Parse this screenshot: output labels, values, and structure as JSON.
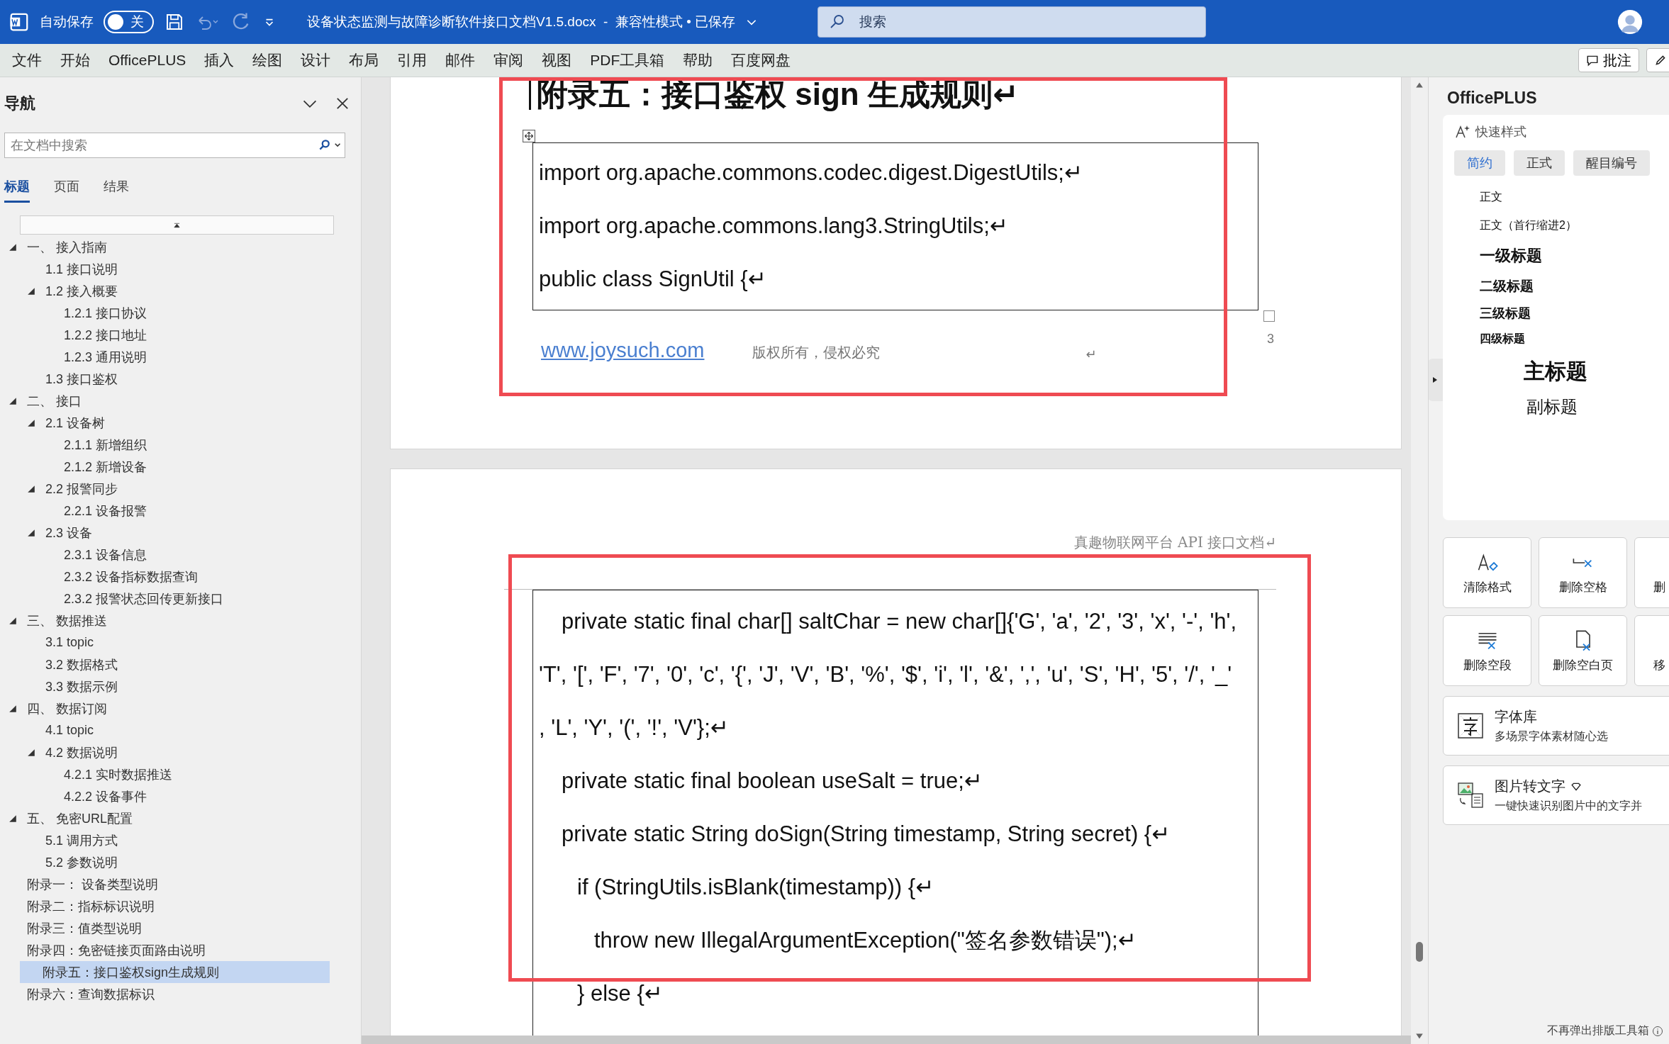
{
  "title_bar": {
    "autosave_label": "自动保存",
    "autosave_toggle": {
      "on": false,
      "label": "关"
    },
    "document_title": "设备状态监测与故障诊断软件接口文档V1.5.docx  -  兼容性模式 • 已保存",
    "search_placeholder": "搜索"
  },
  "ribbon_tabs": [
    "文件",
    "开始",
    "OfficePLUS",
    "插入",
    "绘图",
    "设计",
    "布局",
    "引用",
    "邮件",
    "审阅",
    "视图",
    "PDF工具箱",
    "帮助",
    "百度网盘"
  ],
  "ribbon_buttons": {
    "comment": "批注"
  },
  "navigation": {
    "title": "导航",
    "search_placeholder": "在文档中搜索",
    "tabs": [
      {
        "label": "标题",
        "selected": true
      },
      {
        "label": "页面",
        "selected": false
      },
      {
        "label": "结果",
        "selected": false
      }
    ],
    "outline": [
      {
        "label": "一、 接入指南",
        "expanded": true,
        "selected": false,
        "children": [
          {
            "label": "1.1 接口说明",
            "selected": false
          },
          {
            "label": "1.2 接入概要",
            "expanded": true,
            "selected": false,
            "children": [
              {
                "label": "1.2.1 接口协议",
                "selected": false
              },
              {
                "label": "1.2.2 接口地址",
                "selected": false
              },
              {
                "label": "1.2.3 通用说明",
                "selected": false
              }
            ]
          },
          {
            "label": "1.3 接口鉴权",
            "selected": false
          }
        ]
      },
      {
        "label": "二、 接口",
        "expanded": true,
        "selected": false,
        "children": [
          {
            "label": "2.1 设备树",
            "expanded": true,
            "selected": false,
            "children": [
              {
                "label": "2.1.1 新增组织",
                "selected": false
              },
              {
                "label": "2.1.2 新增设备",
                "selected": false
              }
            ]
          },
          {
            "label": "2.2 报警同步",
            "expanded": true,
            "selected": false,
            "children": [
              {
                "label": "2.2.1 设备报警",
                "selected": false
              }
            ]
          },
          {
            "label": "2.3 设备",
            "expanded": true,
            "selected": false,
            "children": [
              {
                "label": "2.3.1 设备信息",
                "selected": false
              },
              {
                "label": "2.3.2 设备指标数据查询",
                "selected": false
              },
              {
                "label": "2.3.2 报警状态回传更新接口",
                "selected": false
              }
            ]
          }
        ]
      },
      {
        "label": "三、 数据推送",
        "expanded": true,
        "selected": false,
        "children": [
          {
            "label": "3.1 topic",
            "selected": false
          },
          {
            "label": "3.2 数据格式",
            "selected": false
          },
          {
            "label": "3.3 数据示例",
            "selected": false
          }
        ]
      },
      {
        "label": "四、 数据订阅",
        "expanded": true,
        "selected": false,
        "children": [
          {
            "label": "4.1 topic",
            "selected": false
          },
          {
            "label": "4.2 数据说明",
            "expanded": true,
            "selected": false,
            "children": [
              {
                "label": "4.2.1 实时数据推送",
                "selected": false
              },
              {
                "label": "4.2.2 设备事件",
                "selected": false
              }
            ]
          }
        ]
      },
      {
        "label": "五、 免密URL配置",
        "expanded": true,
        "selected": false,
        "children": [
          {
            "label": "5.1 调用方式",
            "selected": false
          },
          {
            "label": "5.2 参数说明",
            "selected": false
          }
        ]
      },
      {
        "label": "附录一： 设备类型说明",
        "selected": false
      },
      {
        "label": "附录二：指标标识说明",
        "selected": false
      },
      {
        "label": "附录三：值类型说明",
        "selected": false
      },
      {
        "label": "附录四：免密链接页面路由说明",
        "selected": false
      },
      {
        "label": "附录五：接口鉴权sign生成规则",
        "selected": true
      },
      {
        "label": "附录六：查询数据标识",
        "selected": false
      }
    ]
  },
  "document": {
    "page_1": {
      "highlighted": true,
      "heading": "附录五：接口鉴权 sign 生成规则↵",
      "code_lines": [
        {
          "text": "import org.apache.commons.codec.digest.DigestUtils;↵",
          "kind": "plain"
        },
        {
          "text": "import org.apache.commons.lang3.StringUtils;↵",
          "kind": "plain"
        },
        {
          "text": "public class SignUtil {↵",
          "kind": "plain"
        }
      ],
      "footer_link": "www.joysuch.com",
      "footer_text": "版权所有，侵权必究",
      "footer_mark": "↵",
      "page_number": "3"
    },
    "page_2": {
      "highlighted": true,
      "header": "真趣物联网平台 API 接口文档↵",
      "code_lines": [
        {
          "text": "private static final char[] saltChar = new char[]{'G', 'a', '2', '3', 'x', '-', 'h',",
          "kind": "member"
        },
        {
          "text": "'T', '[', 'F', '7', '0', 'c', '{', 'J', 'V', 'B', '%', '$', 'i', 'l', '&', ',', 'u', 'S', 'H', '5', '/', '_'",
          "kind": "continuation"
        },
        {
          "text": ", 'L', 'Y', '(', '!', 'V'};↵",
          "kind": "continuation"
        },
        {
          "text": "private static final boolean useSalt = true;↵",
          "kind": "member"
        },
        {
          "text": "private static String doSign(String timestamp, String secret) {↵",
          "kind": "member"
        },
        {
          "text": "if (StringUtils.isBlank(timestamp)) {↵",
          "kind": "block"
        },
        {
          "text": "throw new IllegalArgumentException(\"签名参数错误\");↵",
          "kind": "nested"
        },
        {
          "text": "} else {↵",
          "kind": "block"
        }
      ]
    }
  },
  "office_plus": {
    "title": "OfficePLUS",
    "quick_styles_label": "快速样式",
    "style_tabs": [
      {
        "label": "简约",
        "selected": true
      },
      {
        "label": "正式",
        "selected": false
      },
      {
        "label": "醒目编号",
        "selected": false
      }
    ],
    "styles": [
      {
        "label": "正文",
        "kind": "body"
      },
      {
        "label": "正文（首行缩进2）",
        "kind": "body"
      },
      {
        "label": "一级标题",
        "kind": "h1"
      },
      {
        "label": "二级标题",
        "kind": "h2"
      },
      {
        "label": "三级标题",
        "kind": "h3"
      },
      {
        "label": "四级标题",
        "kind": "h4"
      },
      {
        "label": "主标题",
        "kind": "title"
      },
      {
        "label": "副标题",
        "kind": "subtitle"
      }
    ],
    "tools": [
      {
        "label": "清除格式",
        "kind": "clear-format"
      },
      {
        "label": "删除空格",
        "kind": "delete-spaces"
      },
      {
        "label": "删",
        "kind": "cut"
      },
      {
        "label": "删除空段",
        "kind": "delete-paragraphs"
      },
      {
        "label": "删除空白页",
        "kind": "delete-page"
      },
      {
        "label": "移",
        "kind": "cut"
      }
    ],
    "cards": [
      {
        "title": "字体库",
        "subtitle": "多场景字体素材随心选",
        "kind": "font",
        "premium": false
      },
      {
        "title": "图片转文字",
        "subtitle": "一键快速识别图片中的文字并",
        "kind": "ocr",
        "premium": true
      }
    ],
    "footer": "不再弹出排版工具箱"
  }
}
